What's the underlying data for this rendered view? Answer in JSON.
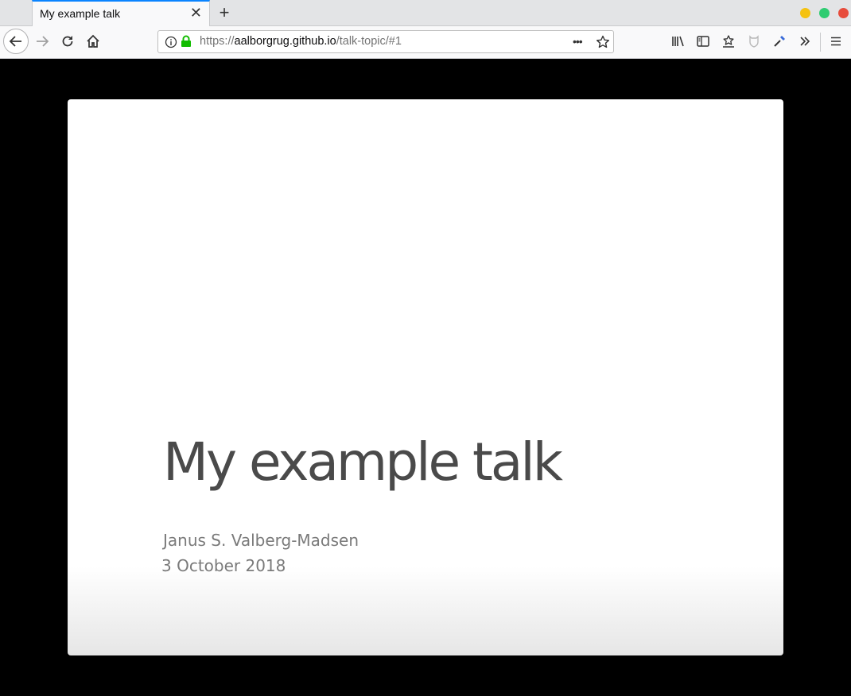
{
  "browser": {
    "tab": {
      "title": "My example talk",
      "close_glyph": "✕"
    },
    "new_tab_glyph": "+",
    "address": {
      "scheme": "https://",
      "host": "aalborgrug.github.io",
      "path": "/talk-topic/#1"
    },
    "page_actions_glyph": "•••",
    "window_controls": {
      "minimize_color": "#f5c211",
      "maximize_color": "#2ecc71",
      "close_color": "#e74c3c"
    }
  },
  "slide": {
    "title": "My example talk",
    "author": "Janus S. Valberg-Madsen",
    "date": "3 October 2018"
  }
}
